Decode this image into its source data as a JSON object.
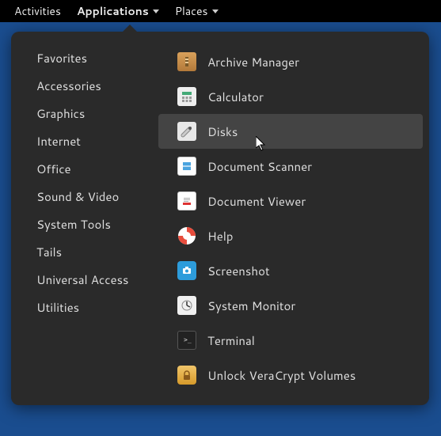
{
  "topbar": {
    "activities": "Activities",
    "applications": "Applications",
    "places": "Places"
  },
  "categories": [
    "Favorites",
    "Accessories",
    "Graphics",
    "Internet",
    "Office",
    "Sound & Video",
    "System Tools",
    "Tails",
    "Universal Access",
    "Utilities"
  ],
  "applications": [
    {
      "label": "Archive Manager",
      "icon": "archive"
    },
    {
      "label": "Calculator",
      "icon": "calculator"
    },
    {
      "label": "Disks",
      "icon": "disks",
      "hover": true
    },
    {
      "label": "Document Scanner",
      "icon": "scanner"
    },
    {
      "label": "Document Viewer",
      "icon": "docviewer"
    },
    {
      "label": "Help",
      "icon": "help"
    },
    {
      "label": "Screenshot",
      "icon": "screenshot"
    },
    {
      "label": "System Monitor",
      "icon": "sysmon"
    },
    {
      "label": "Terminal",
      "icon": "terminal"
    },
    {
      "label": "Unlock VeraCrypt Volumes",
      "icon": "veracrypt"
    }
  ]
}
